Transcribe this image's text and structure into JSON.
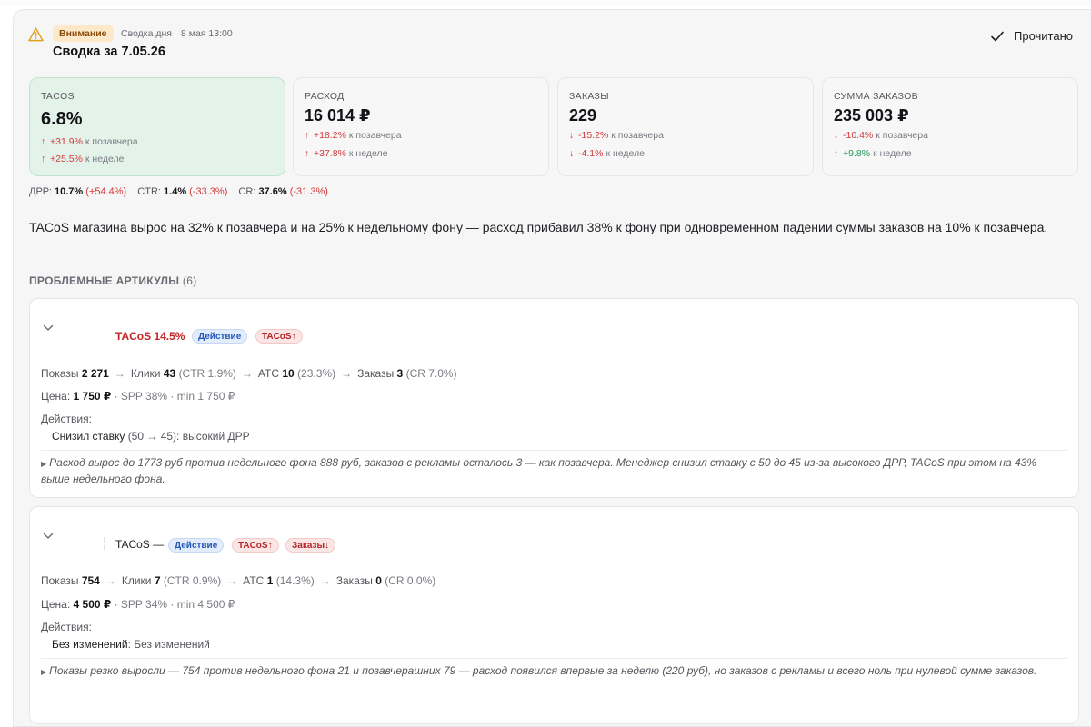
{
  "header": {
    "badge": "Внимание",
    "meta": [
      "Сводка дня",
      "8 мая 13:00"
    ],
    "title": "Сводка за 7.05.26",
    "read_label": "Прочитано"
  },
  "metrics": [
    {
      "label": "TACOS",
      "value": "6.8%",
      "d1": {
        "arrow": "↑",
        "value": "+31.9%",
        "ctx": "к позавчера",
        "color": "red"
      },
      "d2": {
        "arrow": "↑",
        "value": "+25.5%",
        "ctx": "к неделе",
        "color": "red"
      }
    },
    {
      "label": "РАСХОД",
      "value": "16 014 ₽",
      "d1": {
        "arrow": "↑",
        "value": "+18.2%",
        "ctx": "к позавчера",
        "color": "red"
      },
      "d2": {
        "arrow": "↑",
        "value": "+37.8%",
        "ctx": "к неделе",
        "color": "red"
      }
    },
    {
      "label": "ЗАКАЗЫ",
      "value": "229",
      "d1": {
        "arrow": "↓",
        "value": "-15.2%",
        "ctx": "к позавчера",
        "color": "red"
      },
      "d2": {
        "arrow": "↓",
        "value": "-4.1%",
        "ctx": "к неделе",
        "color": "red"
      }
    },
    {
      "label": "СУММА ЗАКАЗОВ",
      "value": "235 003 ₽",
      "d1": {
        "arrow": "↓",
        "value": "-10.4%",
        "ctx": "к позавчера",
        "color": "red"
      },
      "d2": {
        "arrow": "↑",
        "value": "+9.8%",
        "ctx": "к неделе",
        "color": "green"
      }
    }
  ],
  "ratios": [
    {
      "label": "ДРР:",
      "value": "10.7%",
      "delta": "(+54.4%)"
    },
    {
      "label": "CTR:",
      "value": "1.4%",
      "delta": "(-33.3%)"
    },
    {
      "label": "CR:",
      "value": "37.6%",
      "delta": "(-31.3%)"
    }
  ],
  "summary": "TACoS магазина вырос на 32% к позавчера и на 25% к недельному фону — расход прибавил 38% к фону при одновременном падении суммы заказов на 10% к позавчера.",
  "section": {
    "title": "ПРОБЛЕМНЫЕ АРТИКУЛЫ",
    "count": "(6)"
  },
  "items": [
    {
      "tacos": "TACoS 14.5%",
      "tags": [
        "Действие",
        "TACoS↑"
      ],
      "funnel": {
        "shows_label": "Показы",
        "shows": "2 271",
        "clicks_label": "Клики",
        "clicks": "43",
        "ctr": "(CTR 1.9%)",
        "atc_label": "ATC",
        "atc": "10",
        "atc_pct": "(23.3%)",
        "orders_label": "Заказы",
        "orders": "3",
        "cr": "(CR 7.0%)"
      },
      "price": {
        "label": "Цена:",
        "value": "1 750 ₽",
        "spp": "· SPP 38%",
        "min": "· min 1 750 ₽"
      },
      "actions_label": "Действия:",
      "action": {
        "title": "Снизил ставку",
        "detail": "(50 → 45): высокий ДРР"
      },
      "note": "Расход вырос до 1773 руб против недельного фона 888 руб, заказов с рекламы осталось 3 — как позавчера. Менеджер снизил ставку с 50 до 45 из-за высокого ДРР, TACoS при этом на 43% выше недельного фона."
    },
    {
      "tacos": "TACoS —",
      "tags": [
        "Действие",
        "TACoS↑",
        "Заказы↓"
      ],
      "funnel": {
        "shows_label": "Показы",
        "shows": "754",
        "clicks_label": "Клики",
        "clicks": "7",
        "ctr": "(CTR 0.9%)",
        "atc_label": "ATC",
        "atc": "1",
        "atc_pct": "(14.3%)",
        "orders_label": "Заказы",
        "orders": "0",
        "cr": "(CR 0.0%)"
      },
      "price": {
        "label": "Цена:",
        "value": "4 500 ₽",
        "spp": "· SPP 34%",
        "min": "· min 4 500 ₽"
      },
      "actions_label": "Действия:",
      "action": {
        "title": "Без изменений",
        "detail": ": Без изменений"
      },
      "note": "Показы резко выросли — 754 против недельного фона 21 и позавчерашних 79 — расход появился впервые за неделю (220 руб), но заказов с рекламы и всего ноль при нулевой сумме заказов."
    }
  ],
  "colors": {
    "accent_green_bg": "#e3f3ea",
    "negative": "#d43a3a",
    "positive": "#1f9a53",
    "warn_bg": "#fde8c9"
  }
}
